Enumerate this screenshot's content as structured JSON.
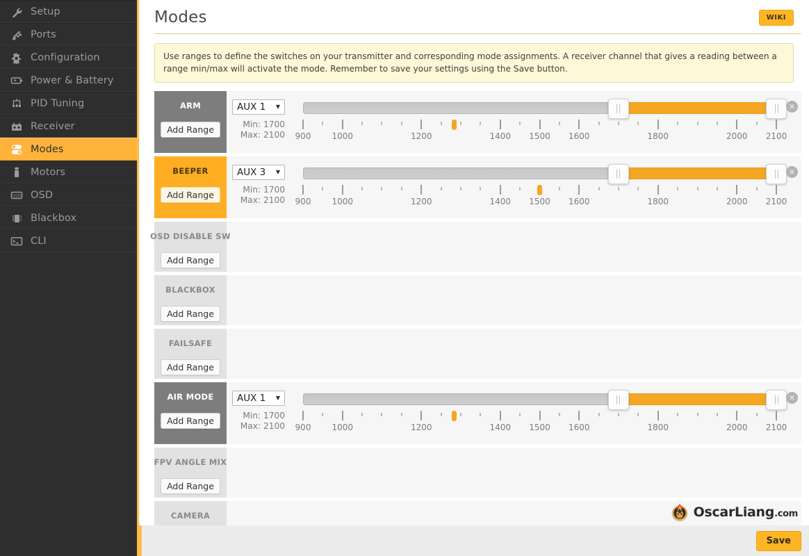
{
  "sidebar": {
    "items": [
      {
        "label": "Setup",
        "icon": "wrench-icon",
        "active": false
      },
      {
        "label": "Ports",
        "icon": "plug-icon",
        "active": false
      },
      {
        "label": "Configuration",
        "icon": "gear-icon",
        "active": false
      },
      {
        "label": "Power & Battery",
        "icon": "battery-icon",
        "active": false
      },
      {
        "label": "PID Tuning",
        "icon": "sliders-icon",
        "active": false
      },
      {
        "label": "Receiver",
        "icon": "remote-icon",
        "active": false
      },
      {
        "label": "Modes",
        "icon": "toggles-icon",
        "active": true
      },
      {
        "label": "Motors",
        "icon": "motor-icon",
        "active": false
      },
      {
        "label": "OSD",
        "icon": "osd-icon",
        "active": false
      },
      {
        "label": "Blackbox",
        "icon": "chip-icon",
        "active": false
      },
      {
        "label": "CLI",
        "icon": "terminal-icon",
        "active": false
      }
    ]
  },
  "header": {
    "title": "Modes",
    "wiki_label": "WIKI"
  },
  "note": "Use ranges to define the switches on your transmitter and corresponding mode assignments. A receiver channel that gives a reading between a range min/max will activate the mode. Remember to save your settings using the Save button.",
  "scale": {
    "min": 900,
    "max": 2100,
    "major_ticks": [
      900,
      1000,
      1200,
      1400,
      1500,
      1600,
      1800,
      2000,
      2100
    ],
    "minor_step": 50
  },
  "labels": {
    "add_range": "Add Range",
    "min_prefix": "Min: ",
    "max_prefix": "Max: ",
    "delete_icon": "close-icon",
    "caret_icon": "chevron-down-icon"
  },
  "modes": [
    {
      "name": "ARM",
      "state": "active",
      "has_range": true,
      "channel": "AUX 1",
      "min": 1700,
      "max": 2100,
      "channel_value": 1283
    },
    {
      "name": "BEEPER",
      "state": "highlight",
      "has_range": true,
      "channel": "AUX 3",
      "min": 1700,
      "max": 2100,
      "channel_value": 1500
    },
    {
      "name": "OSD DISABLE SW",
      "state": "inactive",
      "has_range": false
    },
    {
      "name": "BLACKBOX",
      "state": "inactive",
      "has_range": false
    },
    {
      "name": "FAILSAFE",
      "state": "inactive",
      "has_range": false
    },
    {
      "name": "AIR MODE",
      "state": "active",
      "has_range": true,
      "channel": "AUX 1",
      "min": 1700,
      "max": 2100,
      "channel_value": 1283
    },
    {
      "name": "FPV ANGLE MIX",
      "state": "inactive",
      "has_range": false
    },
    {
      "name": "CAMERA",
      "state": "inactive",
      "has_range": false
    }
  ],
  "footer": {
    "save_label": "Save"
  },
  "watermark": {
    "name": "OscarLiang",
    "suffix": ".com",
    "icon": "flame-logo-icon"
  },
  "colors": {
    "accent": "#ffb524",
    "slider_fill": "#f5a623",
    "sidebar_bg": "#2e2e2e",
    "active_row": "#7d7d7d",
    "highlight_row": "#ffae23"
  }
}
